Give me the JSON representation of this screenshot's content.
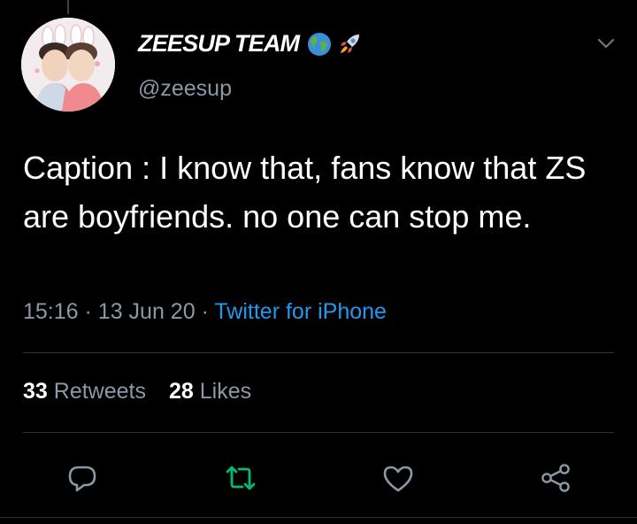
{
  "tweet": {
    "display_name": "ZEESUP TEAM",
    "name_emojis": [
      "globe-icon",
      "rocket-icon"
    ],
    "handle": "@zeesup",
    "text": "Caption : I know that, fans know that ZS are boyfriends. no one can stop me.",
    "time": "15:16",
    "date": "13 Jun 20",
    "separator": "·",
    "source": "Twitter for iPhone",
    "retweet_count": "33",
    "retweet_label": "Retweets",
    "like_count": "28",
    "like_label": "Likes"
  },
  "actions": [
    {
      "name": "reply",
      "icon": "reply-icon"
    },
    {
      "name": "retweet",
      "icon": "retweet-icon",
      "active": true
    },
    {
      "name": "like",
      "icon": "heart-icon"
    },
    {
      "name": "share",
      "icon": "share-icon"
    }
  ],
  "colors": {
    "background": "#000000",
    "text_primary": "#ffffff",
    "text_secondary": "#8b98a5",
    "link": "#1d9bf0",
    "retweet_active": "#00ba7c",
    "divider": "#2f3336"
  }
}
